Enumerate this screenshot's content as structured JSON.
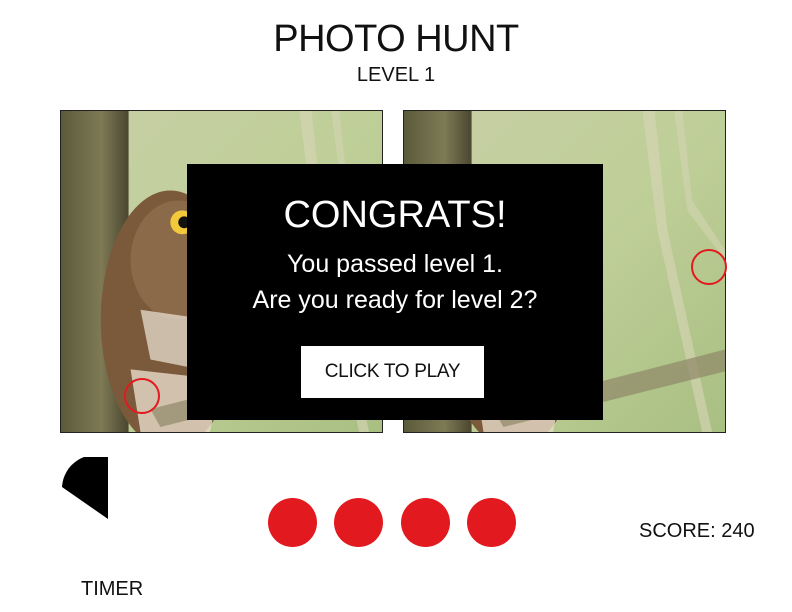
{
  "game": {
    "title": "PHOTO HUNT",
    "level_label": "LEVEL 1"
  },
  "modal": {
    "heading": "CONGRATS!",
    "line1": "You passed level 1.",
    "line2": "Are you ready for level 2?",
    "button_label": "CLICK TO PLAY"
  },
  "hud": {
    "timer_label": "TIMER",
    "score_text": "SCORE: 240",
    "remaining_differences": 4,
    "found_markers": 2
  },
  "images": {
    "left": "owl-photo",
    "right": "owl-photo-modified"
  },
  "colors": {
    "accent_red": "#e21a1f",
    "modal_bg": "#000000",
    "modal_text": "#ffffff"
  },
  "icons": {
    "timer": "timer-pie-icon"
  }
}
